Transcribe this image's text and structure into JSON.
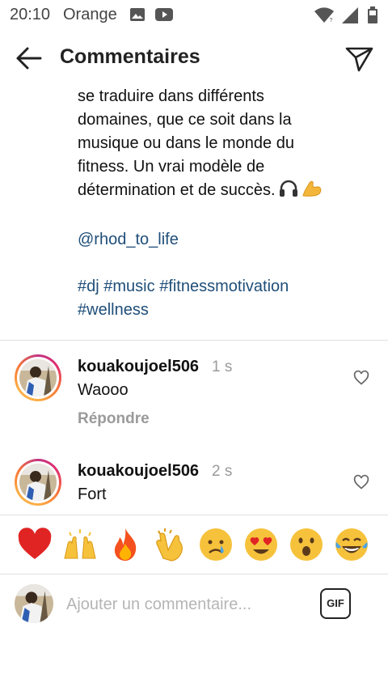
{
  "status_bar": {
    "time": "20:10",
    "carrier": "Orange",
    "icons": [
      "image-icon",
      "youtube-icon",
      "wifi-icon",
      "signal-icon",
      "battery-icon"
    ]
  },
  "header": {
    "title": "Commentaires",
    "back_icon": "arrow-left-icon",
    "send_icon": "paper-plane-icon"
  },
  "caption": {
    "lines": [
      "se traduire dans différents",
      "domaines, que ce soit dans la",
      "musique ou dans le monde du",
      "fitness. Un vrai modèle de",
      "détermination et de succès."
    ],
    "line_emojis": [
      "headphones-icon",
      "flexed-biceps-icon"
    ],
    "mention": "@rhod_to_life",
    "hashtags_line1": [
      "#dj",
      "#music",
      "#fitnessmotivation"
    ],
    "hashtags_line2": [
      "#wellness"
    ]
  },
  "comments": [
    {
      "username": "kouakoujoel506",
      "time": "1 s",
      "text": "Waooo",
      "reply_label": "Répondre"
    },
    {
      "username": "kouakoujoel506",
      "time": "2 s",
      "text": "Fort"
    }
  ],
  "quick_reactions": [
    "red-heart",
    "raising-hands",
    "fire",
    "clapping-hands",
    "crying-face",
    "heart-eyes-face",
    "surprised-face",
    "tears-of-joy-face"
  ],
  "composer": {
    "placeholder": "Ajouter un commentaire...",
    "gif_label": "GIF"
  },
  "colors": {
    "link": "#1f4e79",
    "muted": "#9a9a9a",
    "heart": "#e02424"
  }
}
